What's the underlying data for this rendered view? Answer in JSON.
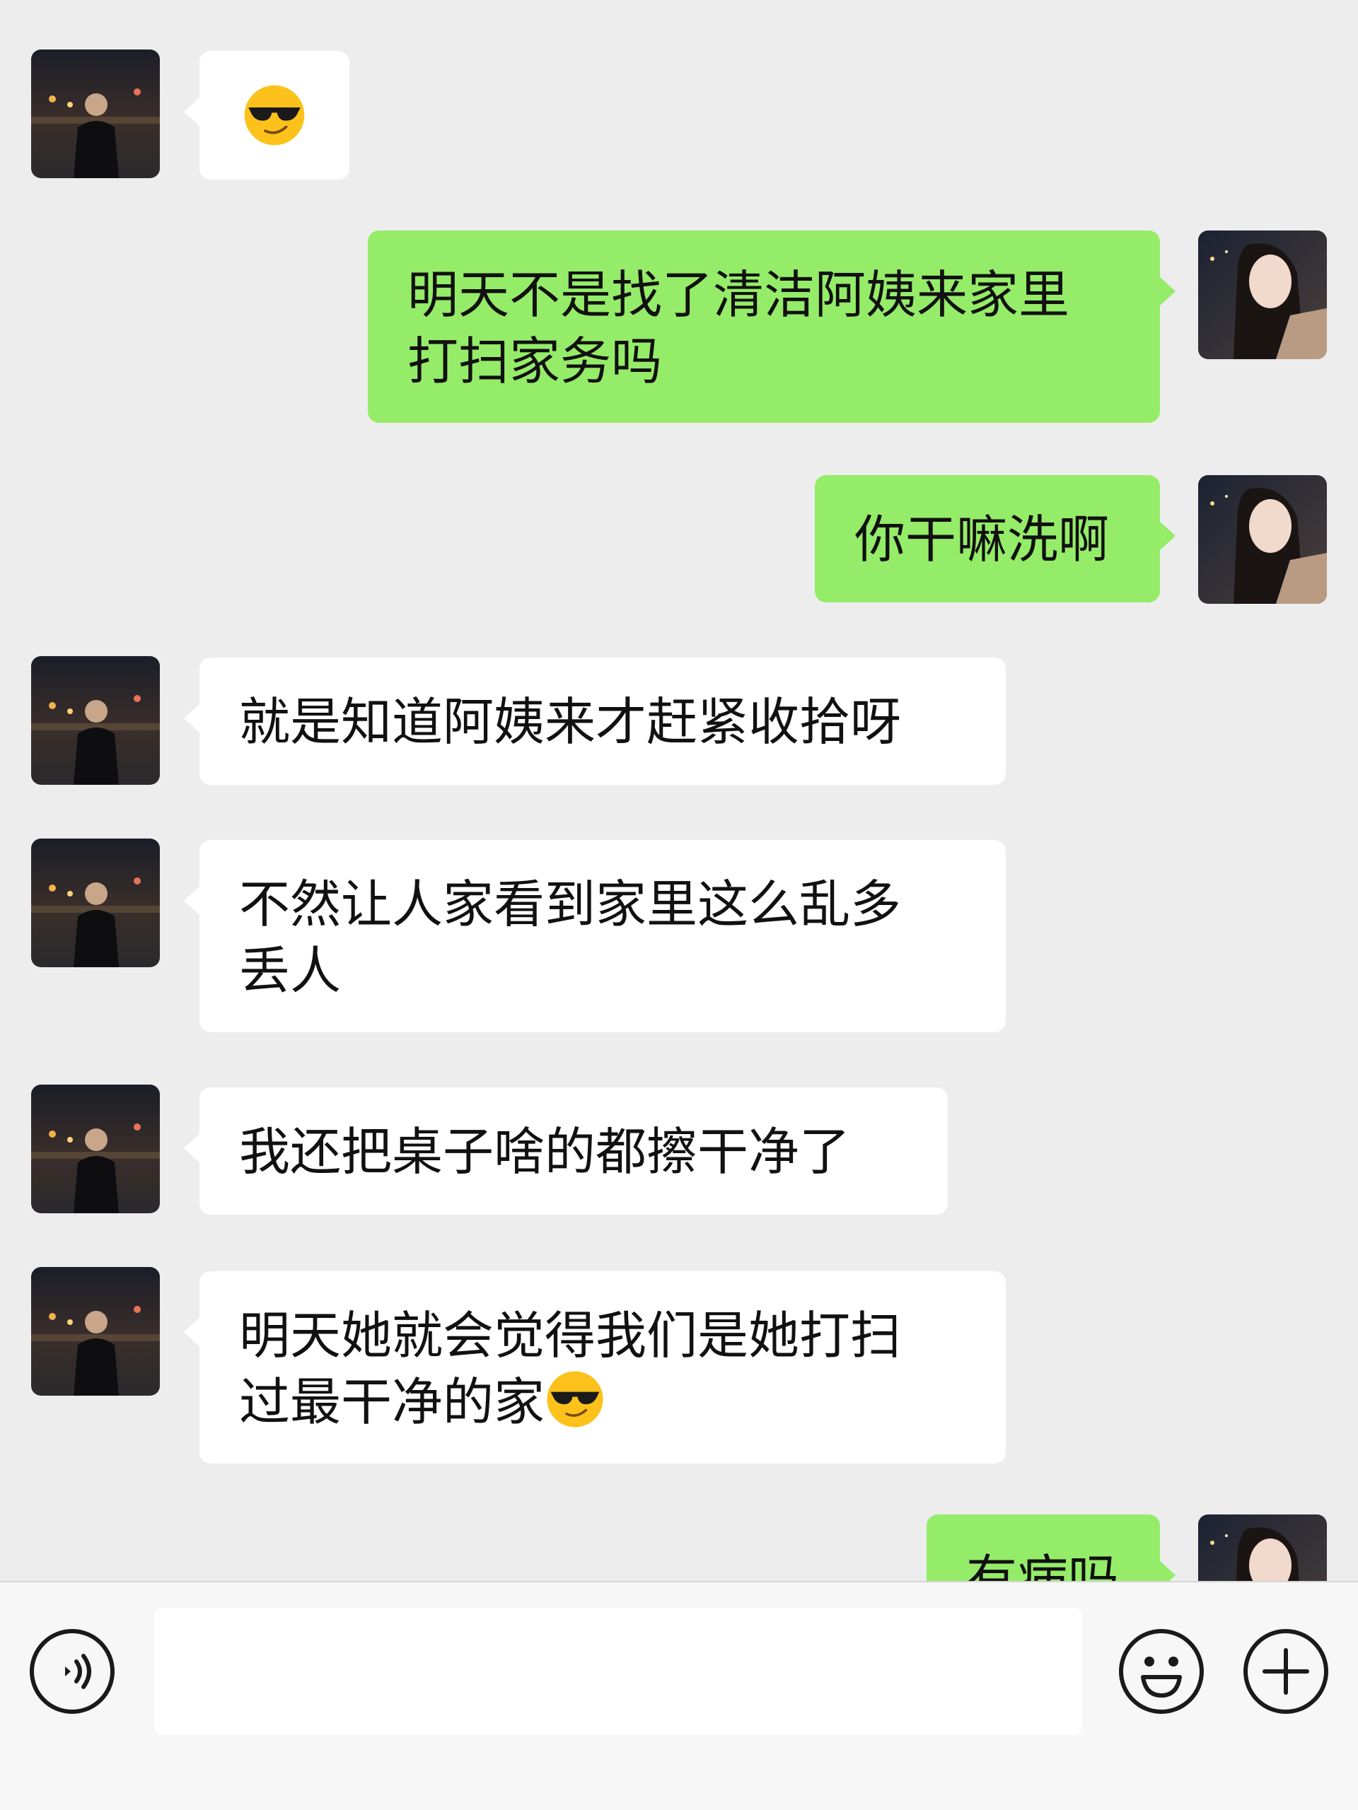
{
  "chat": {
    "messages": [
      {
        "id": "m1",
        "side": "in",
        "text": "",
        "emoji": "sunglasses-emoji"
      },
      {
        "id": "m2",
        "side": "out",
        "text": "明天不是找了清洁阿姨来家里\n打扫家务吗"
      },
      {
        "id": "m3",
        "side": "out",
        "text": "你干嘛洗啊"
      },
      {
        "id": "m4",
        "side": "in",
        "text": "就是知道阿姨来才赶紧收拾呀"
      },
      {
        "id": "m5",
        "side": "in",
        "text": "不然让人家看到家里这么乱多\n丢人"
      },
      {
        "id": "m6",
        "side": "in",
        "text": "我还把桌子啥的都擦干净了"
      },
      {
        "id": "m7",
        "side": "in",
        "text": "明天她就会觉得我们是她打扫\n过最干净的家",
        "emoji": "sunglasses-emoji"
      },
      {
        "id": "m8",
        "side": "out",
        "text": "有病吗"
      }
    ]
  },
  "input_bar": {
    "text_value": "",
    "icons": [
      "voice-icon",
      "emoji-icon",
      "plus-icon"
    ]
  },
  "colors": {
    "background": "#ededed",
    "incoming_bubble": "#ffffff",
    "outgoing_bubble": "#95ec69",
    "input_bar": "#f7f7f7"
  }
}
